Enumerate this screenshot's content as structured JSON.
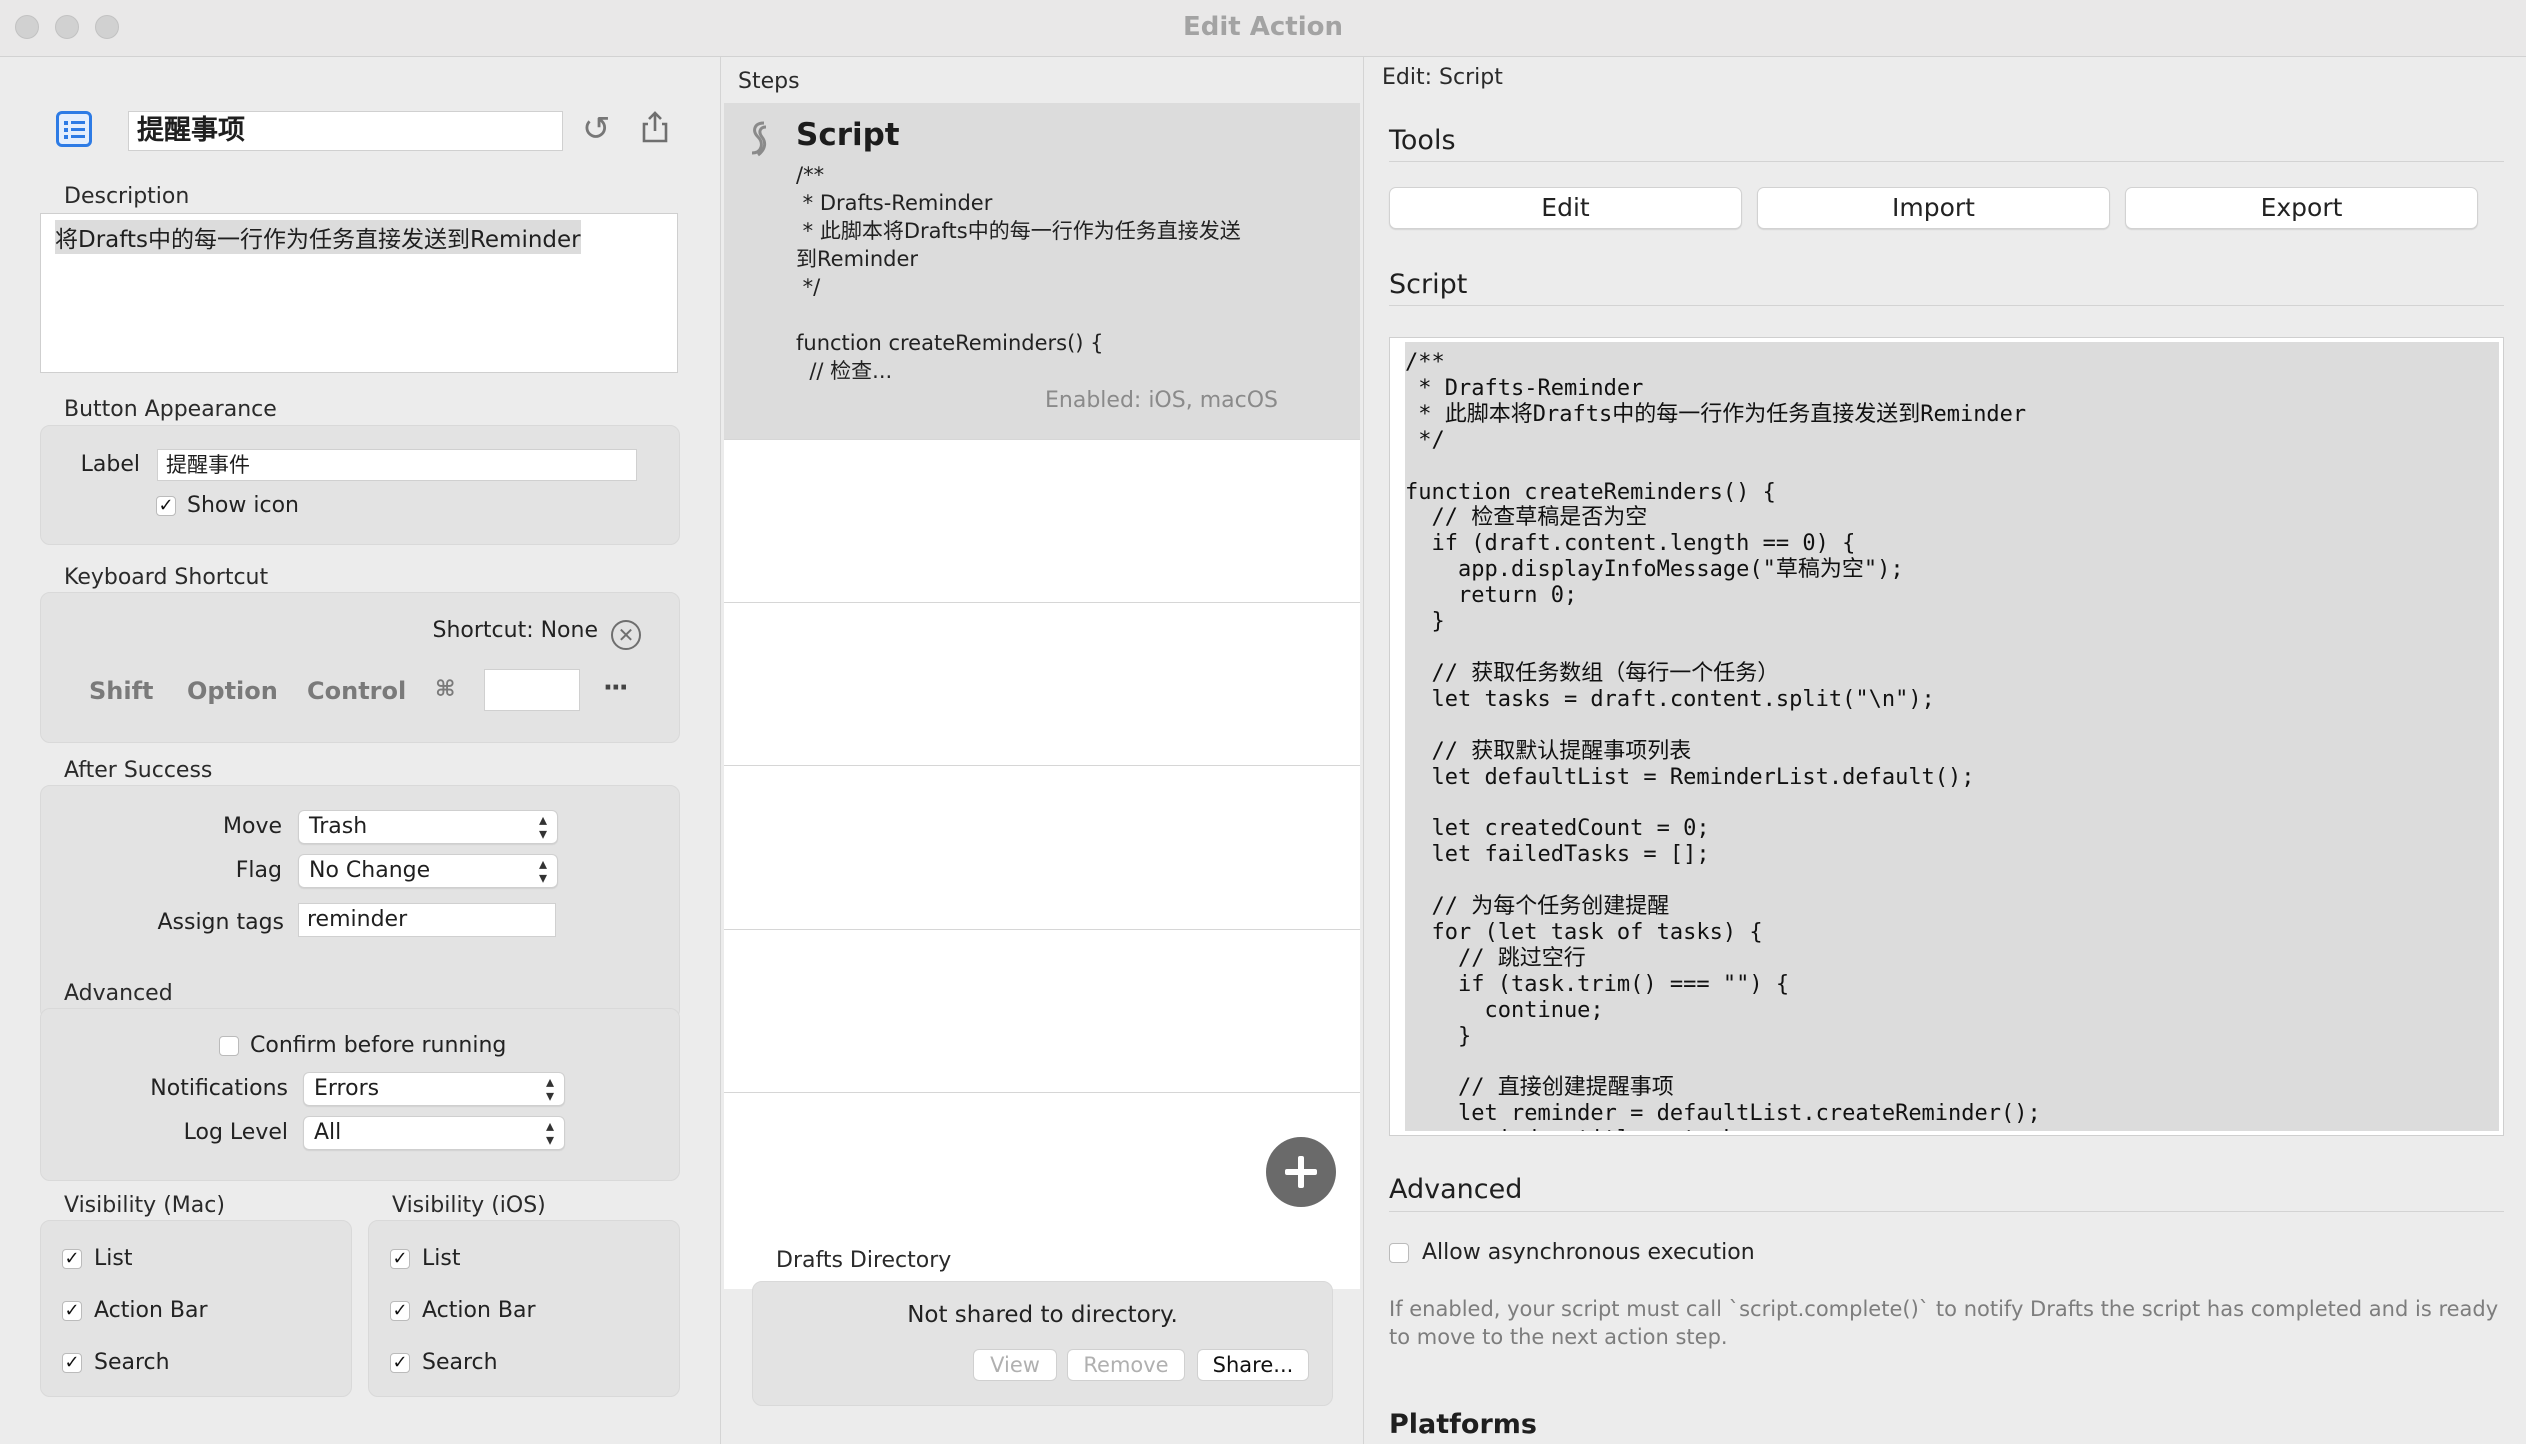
{
  "window": {
    "title": "Edit Action"
  },
  "action": {
    "name": "提醒事项",
    "description_label": "Description",
    "description": "将Drafts中的每一行作为任务直接发送到Reminder"
  },
  "button_appearance": {
    "section": "Button Appearance",
    "label_caption": "Label",
    "label_value": "提醒事件",
    "show_icon": "Show icon"
  },
  "keyboard_shortcut": {
    "section": "Keyboard Shortcut",
    "shortcut_text": "Shortcut: None",
    "shift": "Shift",
    "option": "Option",
    "control": "Control",
    "command_symbol": "⌘",
    "more": "···"
  },
  "after_success": {
    "section": "After Success",
    "move_label": "Move",
    "move_value": "Trash",
    "flag_label": "Flag",
    "flag_value": "No Change",
    "tags_label": "Assign tags",
    "tags_value": "reminder"
  },
  "advanced_left": {
    "section": "Advanced",
    "confirm": "Confirm before running",
    "notifications_label": "Notifications",
    "notifications_value": "Errors",
    "log_label": "Log Level",
    "log_value": "All"
  },
  "visibility_mac": {
    "section": "Visibility (Mac)",
    "items": [
      "List",
      "Action Bar",
      "Search"
    ]
  },
  "visibility_ios": {
    "section": "Visibility (iOS)",
    "items": [
      "List",
      "Action Bar",
      "Search"
    ]
  },
  "steps": {
    "header": "Steps",
    "step_title": "Script",
    "step_preview": "/**\n * Drafts-Reminder\n * 此脚本将Drafts中的每一行作为任务直接发送\n到Reminder\n */\n\nfunction createReminders() {\n  // 检查...",
    "enabled": "Enabled: iOS, macOS"
  },
  "drafts_directory": {
    "section": "Drafts Directory",
    "status": "Not shared to directory.",
    "view": "View",
    "remove": "Remove",
    "share": "Share..."
  },
  "editor": {
    "header": "Edit: Script",
    "tools_heading": "Tools",
    "edit_button": "Edit",
    "import_button": "Import",
    "export_button": "Export",
    "script_heading": "Script",
    "script": "/**\n * Drafts-Reminder\n * 此脚本将Drafts中的每一行作为任务直接发送到Reminder\n */\n\nfunction createReminders() {\n  // 检查草稿是否为空\n  if (draft.content.length == 0) {\n    app.displayInfoMessage(\"草稿为空\");\n    return 0;\n  }\n\n  // 获取任务数组（每行一个任务）\n  let tasks = draft.content.split(\"\\n\");\n\n  // 获取默认提醒事项列表\n  let defaultList = ReminderList.default();\n\n  let createdCount = 0;\n  let failedTasks = [];\n\n  // 为每个任务创建提醒\n  for (let task of tasks) {\n    // 跳过空行\n    if (task.trim() === \"\") {\n      continue;\n    }\n\n    // 直接创建提醒事项\n    let reminder = defaultList.createReminder();\n    reminder.title = task;",
    "advanced_heading": "Advanced",
    "async_label": "Allow asynchronous execution",
    "async_help": "If enabled, your script must call `script.complete()` to notify Drafts the script has completed and is ready to move to the next action step.",
    "platforms_heading": "Platforms"
  },
  "colors": {
    "accent": "#2d7be5",
    "add_button": "#6a6a6a"
  }
}
